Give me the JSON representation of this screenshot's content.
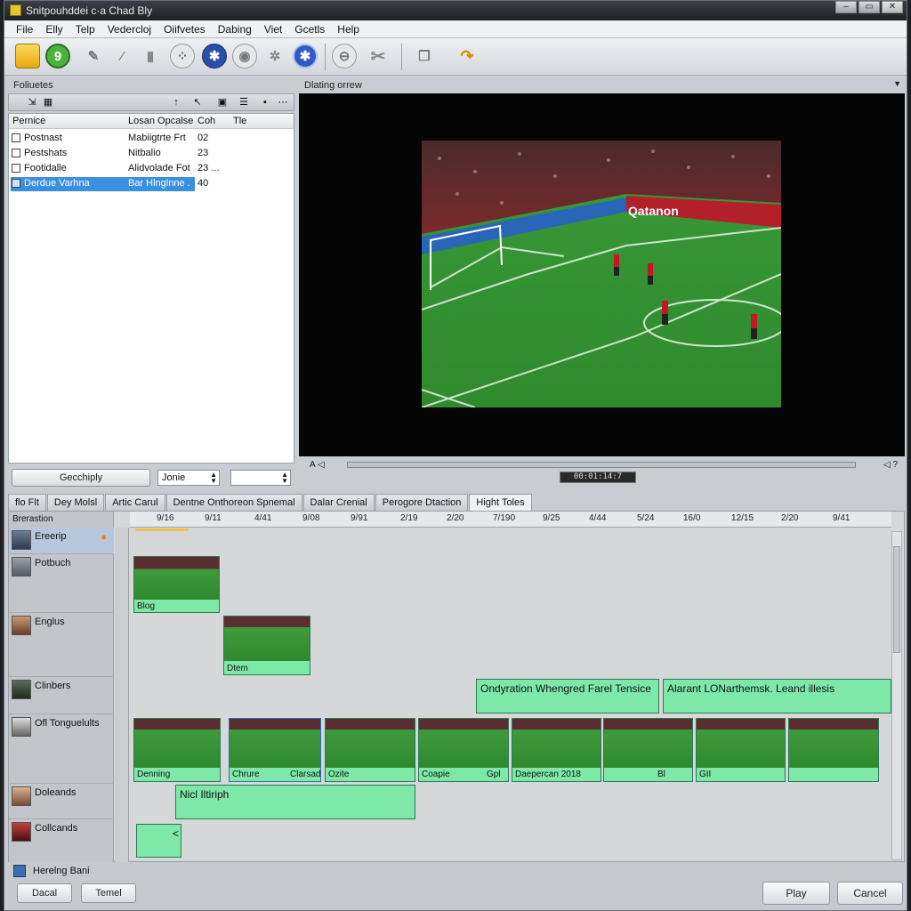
{
  "window": {
    "title": "Snitpouhddei c·a Chad Bly"
  },
  "menu": [
    "File",
    "Elly",
    "Telp",
    "Vedercloj",
    "Oiifvetes",
    "Dabing",
    "Viet",
    "Gcetls",
    "Help"
  ],
  "toolbar": {
    "icons": [
      "folder-icon",
      "refresh-icon",
      "edit-icon",
      "brush-icon",
      "trash-icon",
      "filter-icon",
      "globe-icon",
      "settings-icon",
      "gear-icon",
      "target-icon",
      "eject-icon",
      "cut-icon",
      "copy-icon",
      "undo-icon"
    ]
  },
  "files_panel": {
    "title": "Foliuetes",
    "columns": [
      "Pernice",
      "Losan Opcalse",
      "Coh",
      "Tle"
    ],
    "rows": [
      {
        "name": "Postnast",
        "source": "Mabiigtrte Frt",
        "count": "02"
      },
      {
        "name": "Pestshats",
        "source": "Nitbalio",
        "count": "23"
      },
      {
        "name": "Footidalle",
        "source": "Alidvolade Fot",
        "count": "23 ..."
      },
      {
        "name": "Derdue Varhna",
        "source": "Bar Hlnglnne .",
        "count": "40"
      }
    ],
    "button_left": "Gecchiply",
    "spinner_value": "Jonie",
    "spinner2_value": ""
  },
  "preview": {
    "title": "Dlating orrew",
    "time_left": "A ◁",
    "time_right": "◁ ?",
    "lcd": "00:01:14:7"
  },
  "tabs": [
    "flo Flt",
    "Dey Molsl",
    "Artic Carul",
    "Dentne Onthoreon Spnemal",
    "Dalar Crenial",
    "Perogore Dtaction",
    "Hight Toles"
  ],
  "timeline": {
    "header": "Brerastion",
    "ruler_ticks": [
      "9/16",
      "9/11",
      "4/41",
      "9/08",
      "9/91",
      "2/19",
      "2/20",
      "7/190",
      "9/25",
      "4/44",
      "5/24",
      "16/0",
      "12/15",
      "2/20",
      "9/41"
    ],
    "tracks": [
      {
        "name": "Ereerip"
      },
      {
        "name": "Potbuch"
      },
      {
        "name": "Englus"
      },
      {
        "name": "Clinbers"
      },
      {
        "name": "Ofl Tonguelults"
      },
      {
        "name": "Doleands"
      },
      {
        "name": "Collcands"
      }
    ],
    "clips": {
      "a": "Blog",
      "b": "Dtem",
      "text1": "Ondyration  Whengred Farel Tensice",
      "text2": "Alarant  LONarthemsk. Leand illesis",
      "strip": [
        "Denning",
        "Chrure",
        "Ozite",
        "Coapie",
        "Daepercan 2018",
        "",
        "GII",
        ""
      ],
      "strip_extra": [
        "",
        "Clarsad",
        "",
        "Gpl",
        "",
        "Bl",
        "",
        ""
      ],
      "bottom": "Nicl  Iltiriph",
      "small": "<"
    }
  },
  "footer": {
    "status": "Herelng Bani",
    "buttons_left": [
      "Dacal",
      "Temel"
    ],
    "play": "Play",
    "cancel": "Cancel"
  }
}
